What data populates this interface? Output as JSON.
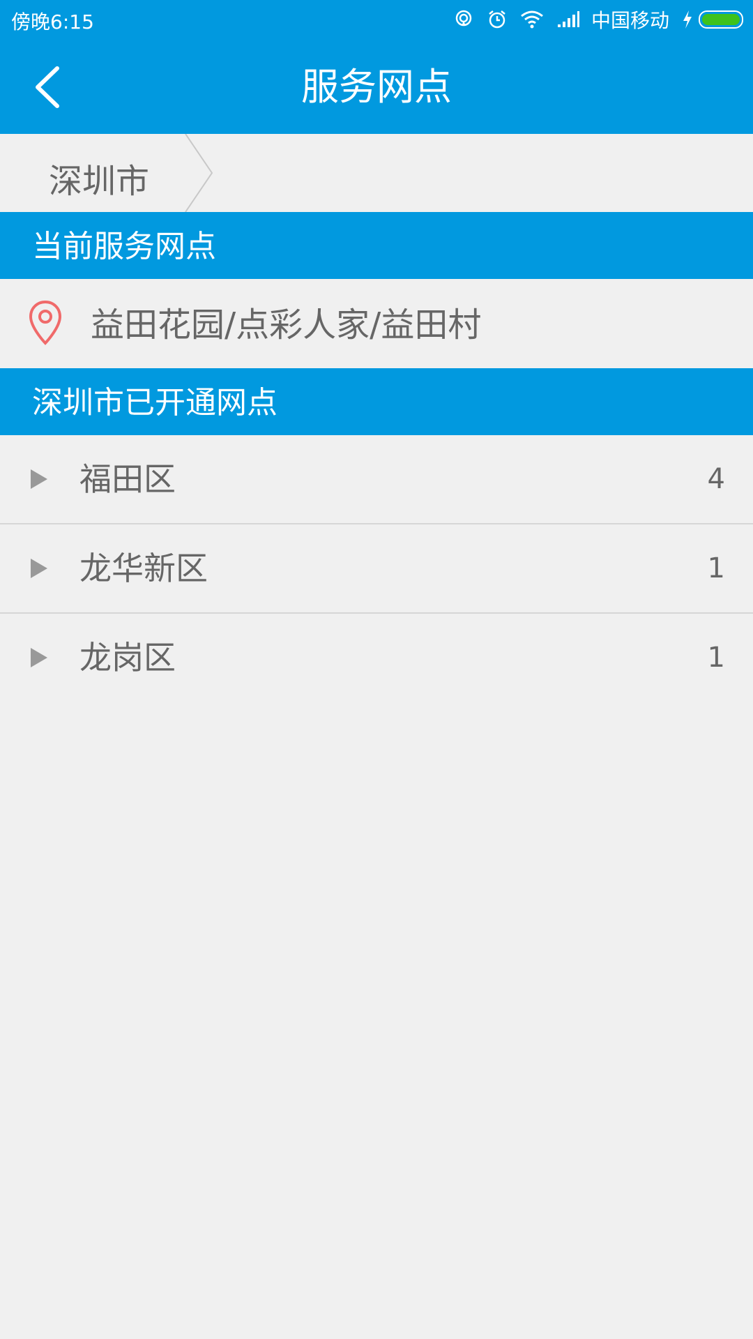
{
  "status_bar": {
    "time": "傍晚6:15",
    "carrier": "中国移动",
    "icons": [
      "hotspot-icon",
      "alarm-icon",
      "wifi-icon",
      "signal-icon",
      "charging-icon",
      "battery-icon"
    ]
  },
  "header": {
    "title": "服务网点",
    "back_icon": "chevron-left-icon"
  },
  "breadcrumb": {
    "city": "深圳市"
  },
  "current_section": {
    "title": "当前服务网点",
    "outlet": "益田花园/点彩人家/益田村",
    "icon": "location-pin-icon"
  },
  "opened_section": {
    "title": "深圳市已开通网点"
  },
  "districts": [
    {
      "name": "福田区",
      "count": "4"
    },
    {
      "name": "龙华新区",
      "count": "1"
    },
    {
      "name": "龙岗区",
      "count": "1"
    }
  ],
  "colors": {
    "primary": "#0199df",
    "background": "#f0f0f0",
    "text": "#666666",
    "pin": "#f06a6a",
    "battery": "#3ec21c"
  }
}
